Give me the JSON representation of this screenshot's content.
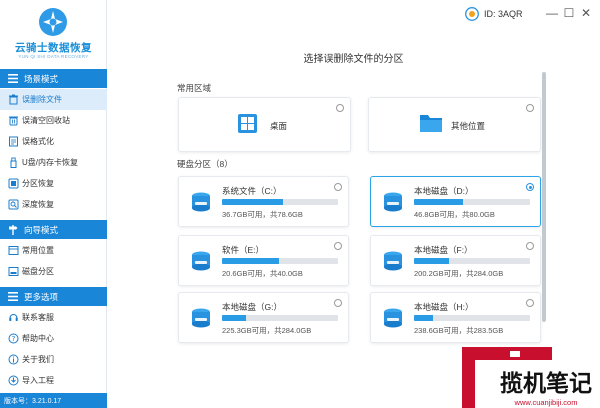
{
  "app": {
    "name": "云骑士数据恢复",
    "subtitle": "YUN QI SHI DATA RECOVERY",
    "version_label": "版本号：3.21.0.17"
  },
  "titlebar": {
    "user_id": "ID: 3AQR",
    "minimize": "—",
    "maximize": "☐",
    "close": "✕"
  },
  "sidebar": {
    "groups": [
      {
        "label": "场景模式",
        "items": [
          {
            "label": "误删除文件",
            "icon": "trash-icon",
            "active": true
          },
          {
            "label": "误清空回收站",
            "icon": "recycle-bin-icon"
          },
          {
            "label": "误格式化",
            "icon": "format-icon"
          },
          {
            "label": "U盘/内存卡恢复",
            "icon": "usb-icon"
          },
          {
            "label": "分区恢复",
            "icon": "partition-icon"
          },
          {
            "label": "深度恢复",
            "icon": "deep-scan-icon"
          }
        ]
      },
      {
        "label": "向导模式",
        "items": [
          {
            "label": "常用位置",
            "icon": "location-icon"
          },
          {
            "label": "磁盘分区",
            "icon": "disk-partition-icon"
          }
        ]
      },
      {
        "label": "更多选项",
        "items": [
          {
            "label": "联系客服",
            "icon": "headset-icon"
          },
          {
            "label": "帮助中心",
            "icon": "help-icon"
          },
          {
            "label": "关于我们",
            "icon": "info-icon"
          },
          {
            "label": "导入工程",
            "icon": "import-icon"
          }
        ]
      }
    ]
  },
  "main": {
    "title": "选择误删除文件的分区",
    "common_label": "常用区域",
    "common_areas": [
      {
        "label": "桌面",
        "icon": "windows-icon"
      },
      {
        "label": "其他位置",
        "icon": "folder-icon"
      }
    ],
    "partitions_label": "硬盘分区（8）",
    "partitions": [
      {
        "name": "系统文件（C:）",
        "info": "36.7GB可用，共78.6GB",
        "used_fraction": 0.53,
        "selected": false
      },
      {
        "name": "本地磁盘（D:）",
        "info": "46.8GB可用，共80.0GB",
        "used_fraction": 0.42,
        "selected": true
      },
      {
        "name": "软件（E:）",
        "info": "20.6GB可用，共40.0GB",
        "used_fraction": 0.49,
        "selected": false
      },
      {
        "name": "本地磁盘（F:）",
        "info": "200.2GB可用，共284.0GB",
        "used_fraction": 0.3,
        "selected": false
      },
      {
        "name": "本地磁盘（G:）",
        "info": "225.3GB可用，共284.0GB",
        "used_fraction": 0.21,
        "selected": false
      },
      {
        "name": "本地磁盘（H:）",
        "info": "238.6GB可用，共283.5GB",
        "used_fraction": 0.16,
        "selected": false
      }
    ]
  },
  "watermark": {
    "text": "揽机笔记",
    "url": "www.cuanjibiji.com"
  }
}
